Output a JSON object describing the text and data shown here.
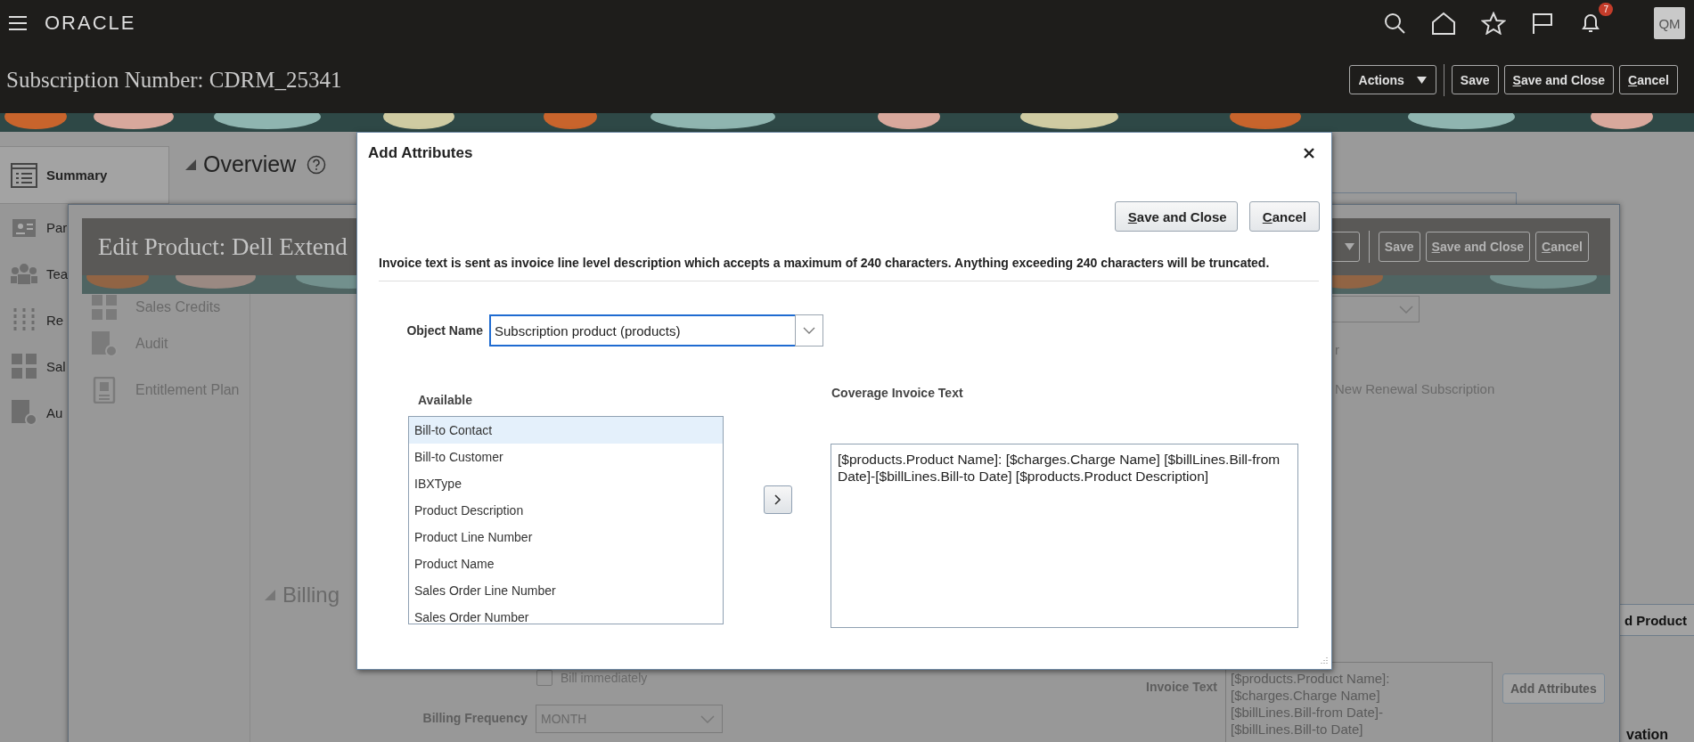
{
  "header": {
    "logo": "ORACLE",
    "notification_count": "7",
    "avatar": "QM"
  },
  "page": {
    "title": "Subscription Number: CDRM_25341",
    "buttons": [
      {
        "label": "Actions",
        "kind": "menu"
      },
      {
        "label": "Save",
        "kind": "plain"
      },
      {
        "label": "Save and Close",
        "kind": "mnemonic"
      },
      {
        "label": "Cancel",
        "kind": "mnemonic"
      }
    ]
  },
  "sidebar": {
    "items": [
      {
        "label": "Summary",
        "selected": true
      },
      {
        "label": "Par",
        "selected": false
      },
      {
        "label": "Tea",
        "selected": false
      },
      {
        "label": "Re",
        "selected": false
      },
      {
        "label": "Sal",
        "selected": false
      },
      {
        "label": "Au",
        "selected": false
      }
    ]
  },
  "overview": {
    "heading": "Overview"
  },
  "add_product_button": "d Product",
  "cut_heading": "vation",
  "edit_product": {
    "title": "Edit Product: Dell Extend",
    "buttons": [
      {
        "label": "Save",
        "kind": "plain"
      },
      {
        "label": "Save and Close",
        "kind": "mnemonic"
      },
      {
        "label": "Cancel",
        "kind": "mnemonic"
      }
    ],
    "nav": [
      "Sales Credits",
      "Audit",
      "Entitlement Plan"
    ],
    "fragment": "r",
    "renewal_text": "New Renewal Subscription",
    "billing": {
      "heading": "Billing",
      "bill_immediately": {
        "label": "Bill immediately",
        "checked": false
      },
      "frequency_label": "Billing Frequency",
      "frequency": "MONTH"
    },
    "invoice_text_label": "Invoice Text",
    "invoice_text_lines": [
      "[$products.Product Name]:",
      "[$charges.Charge Name]",
      "[$billLines.Bill-from Date]-",
      "[$billLines.Bill-to Date]"
    ],
    "add_attributes": "Add Attributes"
  },
  "dialog": {
    "title": "Add Attributes",
    "buttons": [
      {
        "label": "Save and Close",
        "kind": "mnemonic"
      },
      {
        "label": "Cancel",
        "kind": "mnemonic"
      }
    ],
    "notice": "Invoice text is sent as invoice line level description which accepts a maximum of 240 characters. Anything exceeding 240 characters will be truncated.",
    "object_name_label": "Object Name",
    "object_name": "Subscription product (products)",
    "available_label": "Available",
    "available": [
      {
        "label": "Bill-to Contact",
        "selected": true
      },
      {
        "label": "Bill-to Customer",
        "selected": false
      },
      {
        "label": "IBXType",
        "selected": false
      },
      {
        "label": "Product Description",
        "selected": false
      },
      {
        "label": "Product Line Number",
        "selected": false
      },
      {
        "label": "Product Name",
        "selected": false
      },
      {
        "label": "Sales Order Line Number",
        "selected": false
      },
      {
        "label": "Sales Order Number",
        "selected": false
      }
    ],
    "coverage_label": "Coverage Invoice Text",
    "coverage_text": "[$products.Product Name]: [$charges.Charge Name] [$billLines.Bill-from Date]-[$billLines.Bill-to Date] [$products.Product Description]"
  }
}
